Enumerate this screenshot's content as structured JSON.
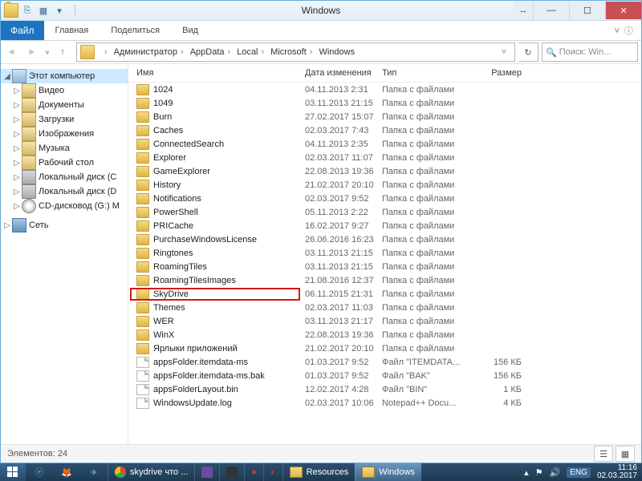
{
  "window": {
    "title": "Windows"
  },
  "menubar": {
    "file_tab": "Файл",
    "tabs": [
      "Главная",
      "Поделиться",
      "Вид"
    ]
  },
  "address": {
    "crumbs": [
      "Администратор",
      "AppData",
      "Local",
      "Microsoft",
      "Windows"
    ]
  },
  "search": {
    "placeholder": "Поиск: Win..."
  },
  "nav": {
    "root": "Этот компьютер",
    "items": [
      {
        "label": "Видео",
        "kind": "lib"
      },
      {
        "label": "Документы",
        "kind": "lib"
      },
      {
        "label": "Загрузки",
        "kind": "lib"
      },
      {
        "label": "Изображения",
        "kind": "lib"
      },
      {
        "label": "Музыка",
        "kind": "lib"
      },
      {
        "label": "Рабочий стол",
        "kind": "lib"
      },
      {
        "label": "Локальный диск (C",
        "kind": "drive"
      },
      {
        "label": "Локальный диск (D",
        "kind": "drive"
      },
      {
        "label": "CD-дисковод (G:) M",
        "kind": "cd"
      }
    ],
    "network": "Сеть"
  },
  "columns": {
    "name": "Имя",
    "date": "Дата изменения",
    "type": "Тип",
    "size": "Размер"
  },
  "rows": [
    {
      "ico": "folder",
      "name": "1024",
      "date": "04.11.2013 2:31",
      "type": "Папка с файлами",
      "size": ""
    },
    {
      "ico": "folder",
      "name": "1049",
      "date": "03.11.2013 21:15",
      "type": "Папка с файлами",
      "size": ""
    },
    {
      "ico": "folder",
      "name": "Burn",
      "date": "27.02.2017 15:07",
      "type": "Папка с файлами",
      "size": ""
    },
    {
      "ico": "folder",
      "name": "Caches",
      "date": "02.03.2017 7:43",
      "type": "Папка с файлами",
      "size": ""
    },
    {
      "ico": "folder",
      "name": "ConnectedSearch",
      "date": "04.11.2013 2:35",
      "type": "Папка с файлами",
      "size": ""
    },
    {
      "ico": "folder",
      "name": "Explorer",
      "date": "02.03.2017 11:07",
      "type": "Папка с файлами",
      "size": ""
    },
    {
      "ico": "folder",
      "name": "GameExplorer",
      "date": "22.08.2013 19:36",
      "type": "Папка с файлами",
      "size": ""
    },
    {
      "ico": "folder",
      "name": "History",
      "date": "21.02.2017 20:10",
      "type": "Папка с файлами",
      "size": ""
    },
    {
      "ico": "folder",
      "name": "Notifications",
      "date": "02.03.2017 9:52",
      "type": "Папка с файлами",
      "size": ""
    },
    {
      "ico": "folder",
      "name": "PowerShell",
      "date": "05.11.2013 2:22",
      "type": "Папка с файлами",
      "size": ""
    },
    {
      "ico": "folder",
      "name": "PRICache",
      "date": "16.02.2017 9:27",
      "type": "Папка с файлами",
      "size": ""
    },
    {
      "ico": "folder",
      "name": "PurchaseWindowsLicense",
      "date": "26.06.2016 16:23",
      "type": "Папка с файлами",
      "size": ""
    },
    {
      "ico": "folder",
      "name": "Ringtones",
      "date": "03.11.2013 21:15",
      "type": "Папка с файлами",
      "size": ""
    },
    {
      "ico": "folder",
      "name": "RoamingTiles",
      "date": "03.11.2013 21:15",
      "type": "Папка с файлами",
      "size": ""
    },
    {
      "ico": "folder",
      "name": "RoamingTilesImages",
      "date": "21.08.2016 12:37",
      "type": "Папка с файлами",
      "size": ""
    },
    {
      "ico": "folder",
      "name": "SkyDrive",
      "date": "06.11.2015 21:31",
      "type": "Папка с файлами",
      "size": "",
      "hl": true
    },
    {
      "ico": "folder",
      "name": "Themes",
      "date": "02.03.2017 11:03",
      "type": "Папка с файлами",
      "size": ""
    },
    {
      "ico": "folder",
      "name": "WER",
      "date": "03.11.2013 21:17",
      "type": "Папка с файлами",
      "size": ""
    },
    {
      "ico": "folder",
      "name": "WinX",
      "date": "22.08.2013 19:36",
      "type": "Папка с файлами",
      "size": ""
    },
    {
      "ico": "shortcut",
      "name": "Ярлыки приложений",
      "date": "21.02.2017 20:10",
      "type": "Папка с файлами",
      "size": ""
    },
    {
      "ico": "file",
      "name": "appsFolder.itemdata-ms",
      "date": "01.03.2017 9:52",
      "type": "Файл \"ITEMDATA...",
      "size": "156 КБ"
    },
    {
      "ico": "file",
      "name": "appsFolder.itemdata-ms.bak",
      "date": "01.03.2017 9:52",
      "type": "Файл \"BAK\"",
      "size": "156 КБ"
    },
    {
      "ico": "file",
      "name": "appsFolderLayout.bin",
      "date": "12.02.2017 4:28",
      "type": "Файл \"BIN\"",
      "size": "1 КБ"
    },
    {
      "ico": "file",
      "name": "WindowsUpdate.log",
      "date": "02.03.2017 10:06",
      "type": "Notepad++ Docu...",
      "size": "4 КБ"
    }
  ],
  "status": {
    "count_label": "Элементов: 24"
  },
  "taskbar": {
    "tasks": [
      {
        "label": "skydrive что ...",
        "active": false,
        "icon": "chrome"
      },
      {
        "label": "",
        "active": false,
        "icon": "app1"
      },
      {
        "label": "",
        "active": false,
        "icon": "app2"
      },
      {
        "label": "",
        "active": false,
        "icon": "rec"
      },
      {
        "label": "",
        "active": false,
        "icon": "cc"
      },
      {
        "label": "Resources",
        "active": false,
        "icon": "folder"
      },
      {
        "label": "Windows",
        "active": true,
        "icon": "folder"
      }
    ],
    "lang": "ENG",
    "time": "11:16",
    "date": "02.03.2017"
  }
}
